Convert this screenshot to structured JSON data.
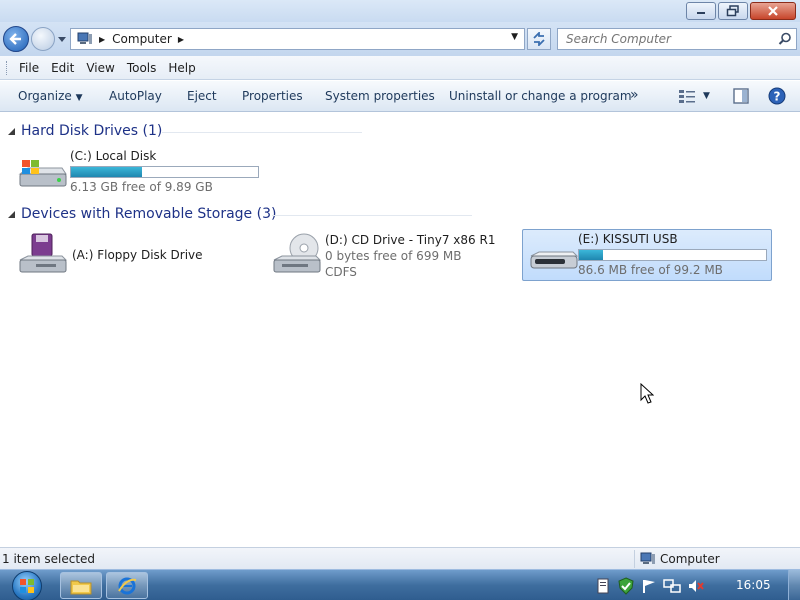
{
  "window": {
    "buttons": [
      "minimize",
      "maximize",
      "close"
    ]
  },
  "address": {
    "crumb": "Computer",
    "search_placeholder": "Search Computer"
  },
  "menu": {
    "items": [
      "File",
      "Edit",
      "View",
      "Tools",
      "Help"
    ]
  },
  "commands": {
    "organize": "Organize",
    "autoplay": "AutoPlay",
    "eject": "Eject",
    "properties": "Properties",
    "system_properties": "System properties",
    "uninstall": "Uninstall or change a program",
    "more": "»"
  },
  "groups": {
    "hard_disks": {
      "label": "Hard Disk Drives (1)",
      "drives": [
        {
          "name": "(C:) Local Disk",
          "free_text": "6.13 GB free of 9.89 GB",
          "used_fraction": 0.38
        }
      ]
    },
    "removable": {
      "label": "Devices with Removable Storage (3)",
      "drives": [
        {
          "name": "(A:) Floppy Disk Drive"
        },
        {
          "name": "(D:) CD Drive - Tiny7 x86 R1",
          "free_text": "0 bytes free of 699 MB",
          "fs": "CDFS"
        },
        {
          "name": "(E:) KISSUTI USB",
          "free_text": "86.6 MB free of 99.2 MB",
          "used_fraction": 0.13,
          "selected": true
        }
      ]
    }
  },
  "status": {
    "selection": "1 item selected",
    "location": "Computer"
  },
  "taskbar": {
    "clock": "16:05"
  },
  "colors": {
    "group_header": "#1e3287",
    "bar_fill": "#2a9dc6",
    "selected_tile": "#cce4fc"
  }
}
